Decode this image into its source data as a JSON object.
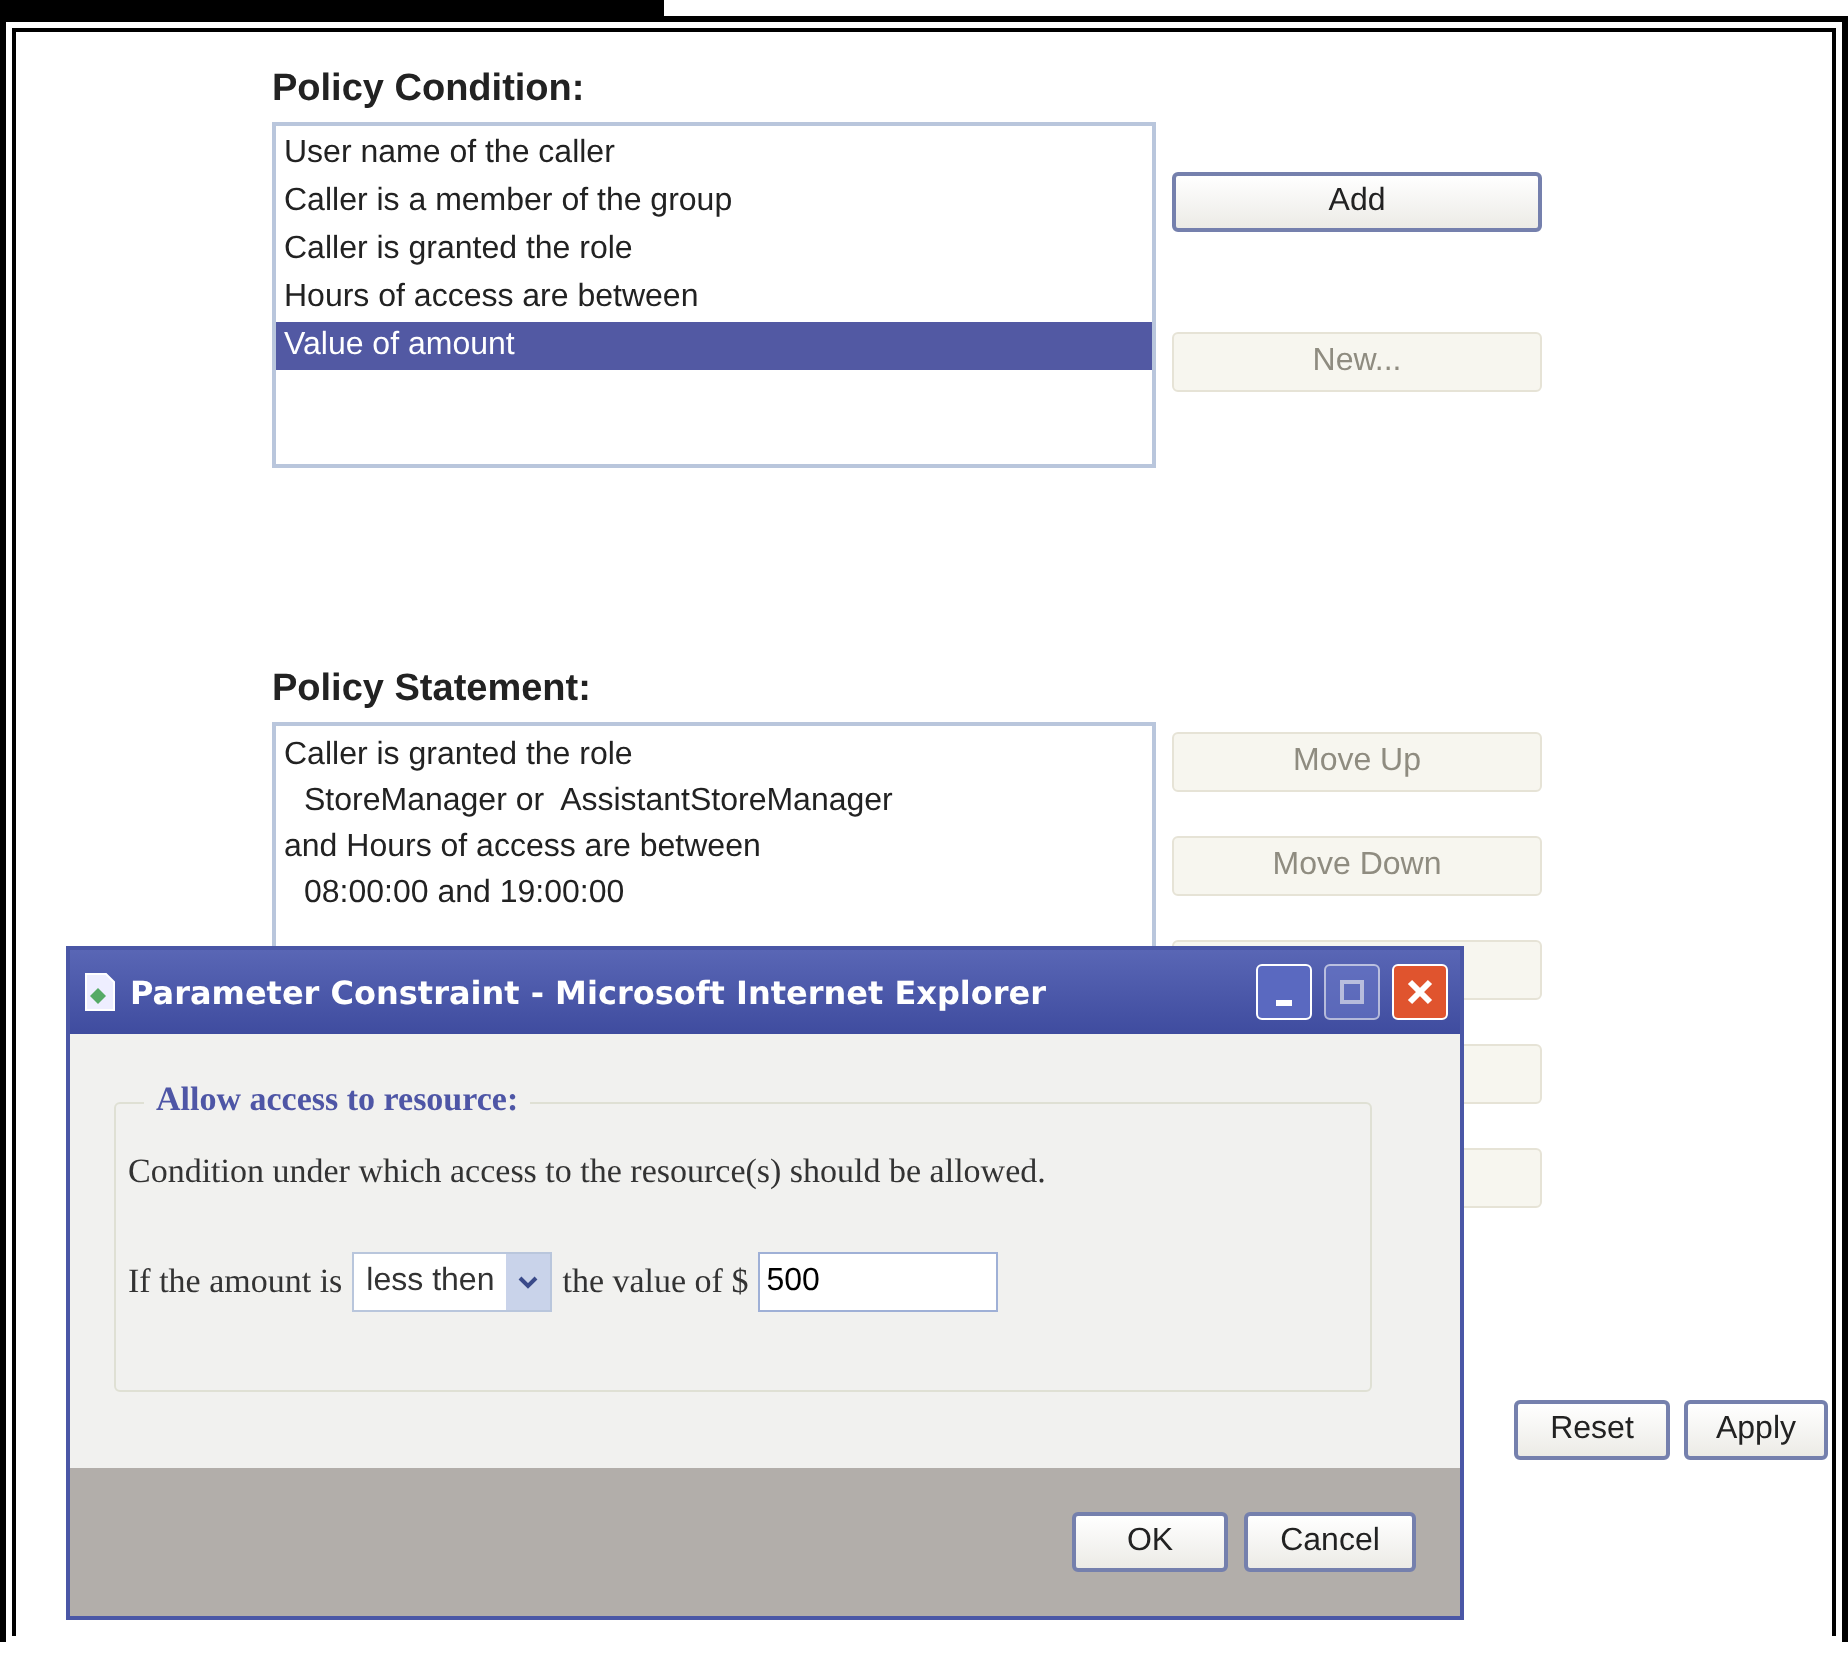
{
  "policy_condition": {
    "heading": "Policy Condition:",
    "options": [
      {
        "label": "User name of the caller",
        "selected": false
      },
      {
        "label": "Caller is a member of the group",
        "selected": false
      },
      {
        "label": "Caller is granted the role",
        "selected": false
      },
      {
        "label": "Hours of access are between",
        "selected": false
      },
      {
        "label": "Value of amount",
        "selected": true
      }
    ],
    "buttons": [
      {
        "label": "Add",
        "disabled": false
      },
      {
        "label": "New...",
        "disabled": true
      }
    ]
  },
  "policy_statement": {
    "heading": "Policy Statement:",
    "lines": [
      {
        "text": "Caller is granted the role",
        "children": [
          {
            "text": "StoreManager or  AssistantStoreManager"
          }
        ]
      },
      {
        "text": "and Hours of access are between",
        "children": [
          {
            "text": "08:00:00 and 19:00:00"
          }
        ]
      }
    ],
    "buttons": [
      {
        "label": "Move Up",
        "disabled": true
      },
      {
        "label": "Move Down",
        "disabled": true
      },
      {
        "disabled": true
      },
      {
        "disabled": true
      },
      {
        "disabled": true
      }
    ]
  },
  "form_buttons": [
    {
      "label": "Reset"
    },
    {
      "label": "Apply"
    }
  ],
  "dialog": {
    "title": "Parameter Constraint - Microsoft Internet Explorer",
    "legend": "Allow access to resource:",
    "description": "Condition under which access to the resource(s) should be allowed.",
    "condition_prefix": "If the amount is",
    "operator": "less then",
    "condition_middle": "the value of $",
    "amount_value": "500",
    "buttons": [
      "OK",
      "Cancel"
    ]
  }
}
